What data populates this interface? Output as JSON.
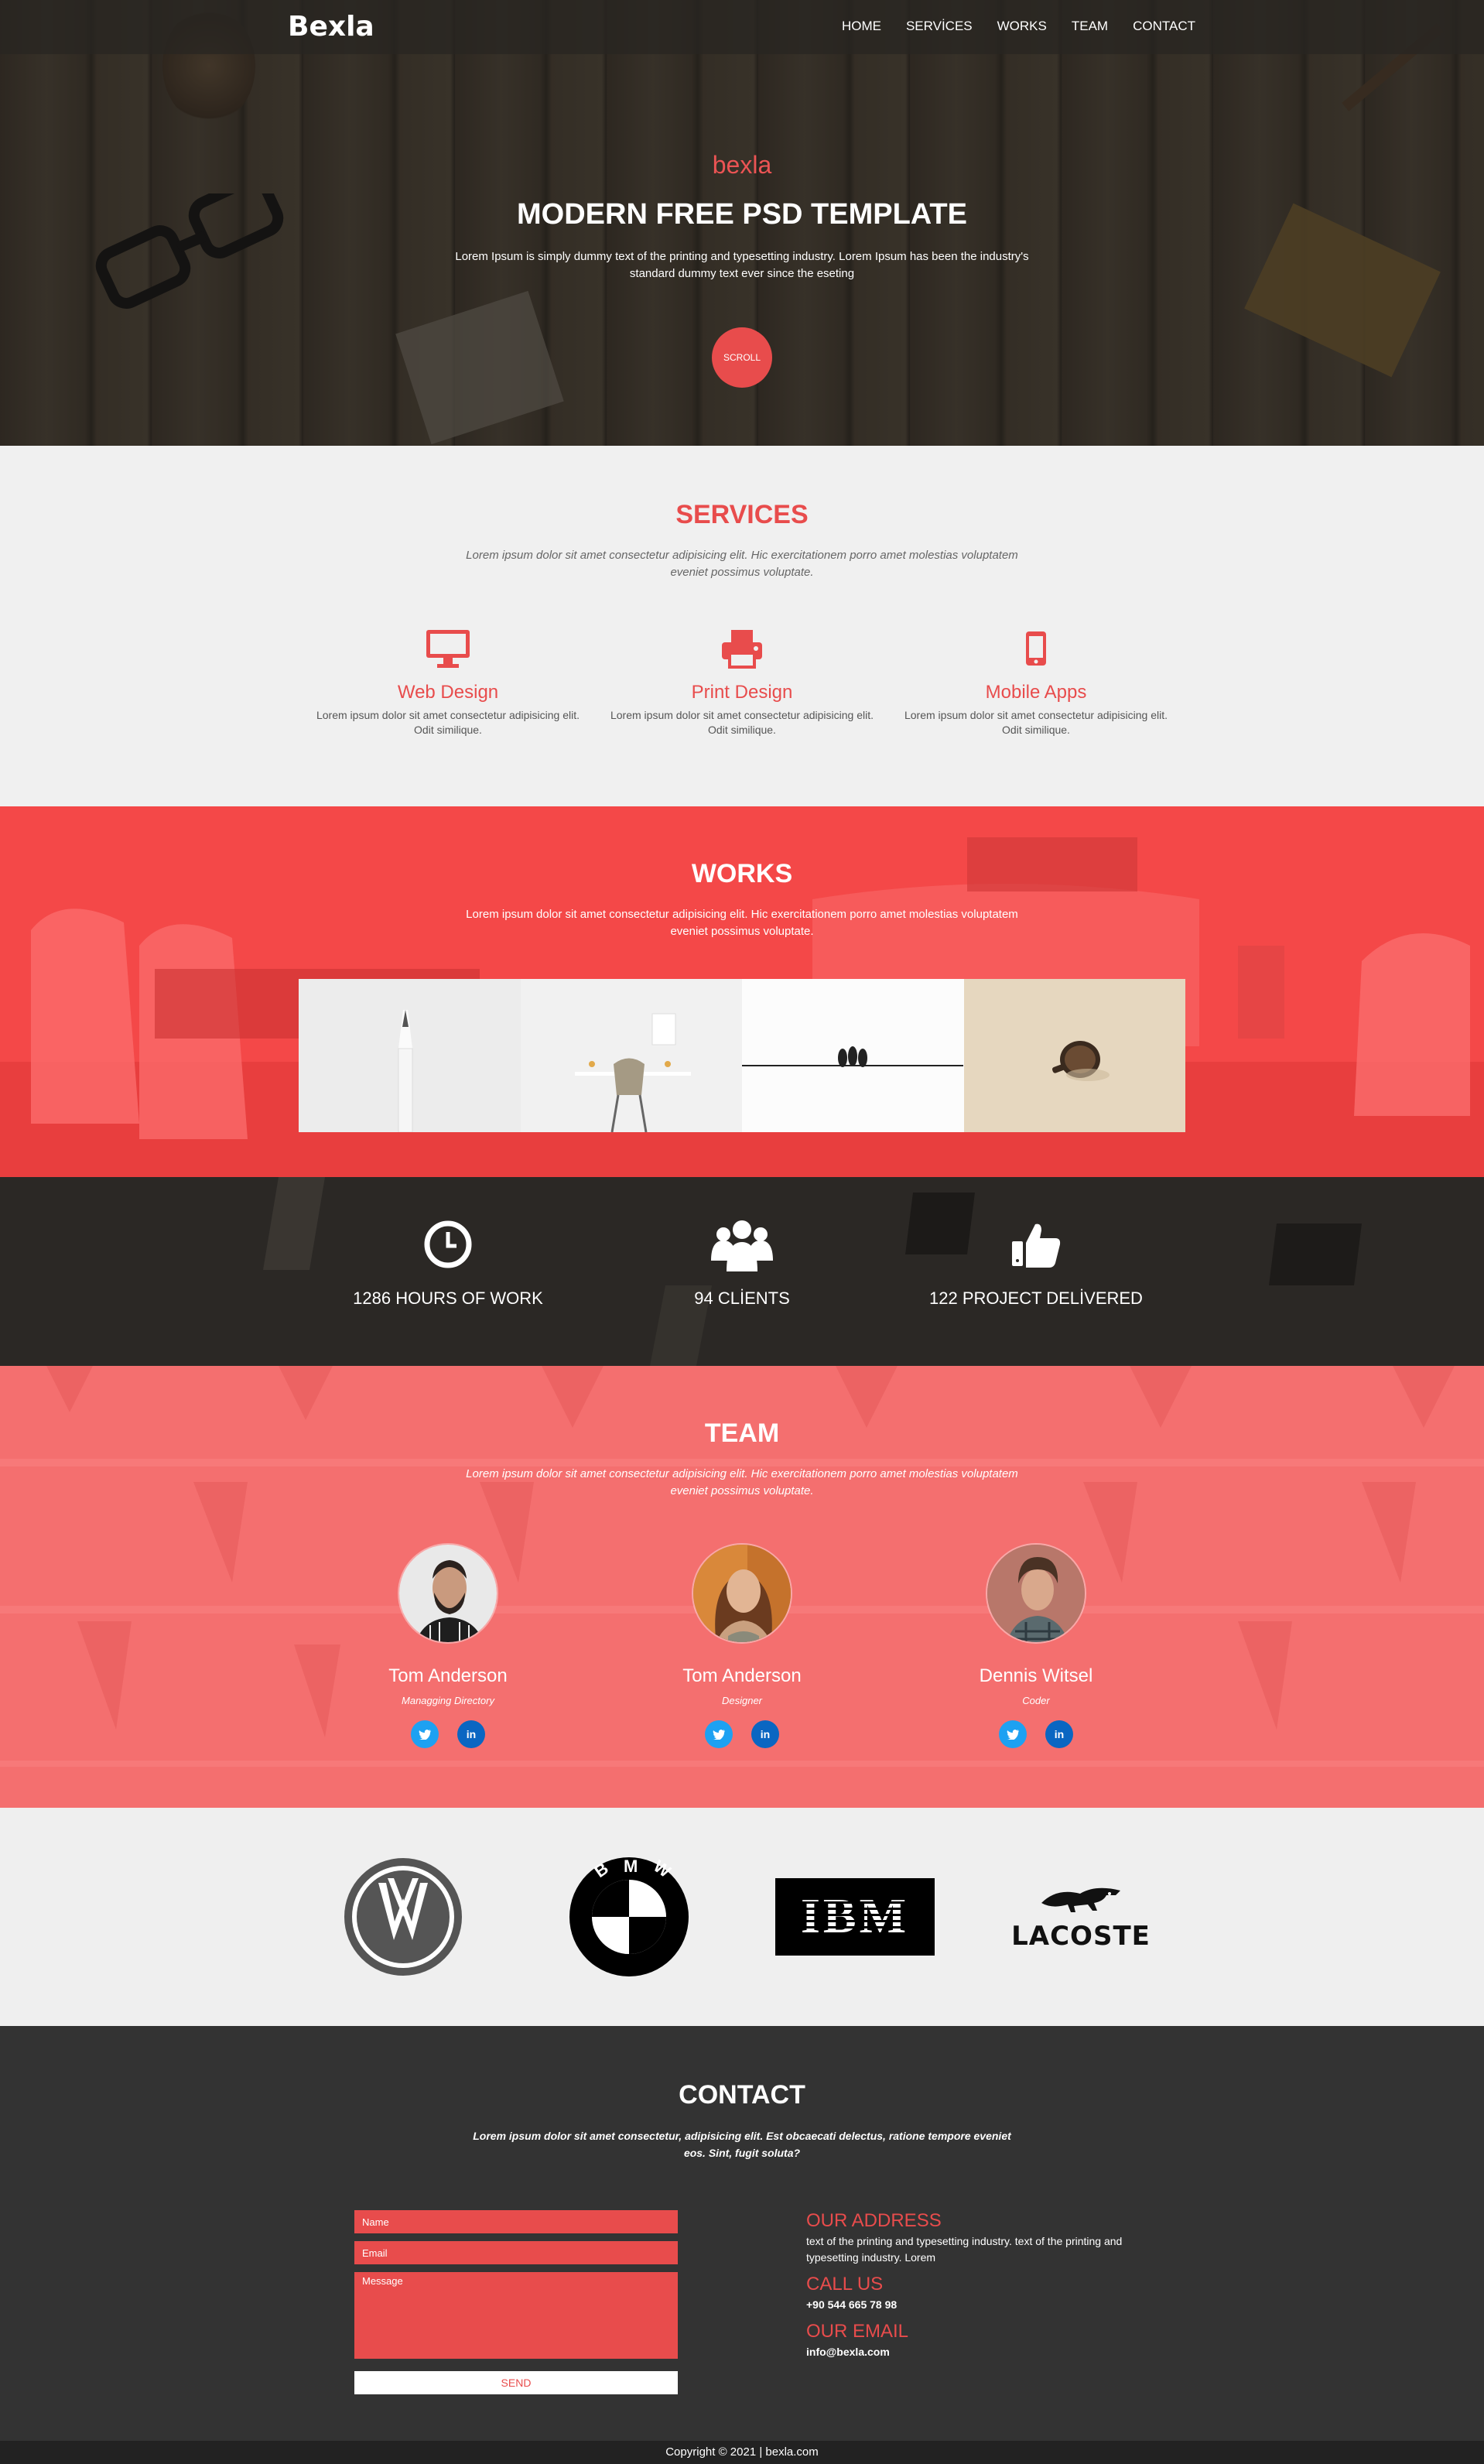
{
  "nav": {
    "logo": "Bexla",
    "items": [
      "HOME",
      "SERVİCES",
      "WORKS",
      "TEAM",
      "CONTACT"
    ]
  },
  "hero": {
    "brand": "bexla",
    "title": "MODERN FREE PSD TEMPLATE",
    "text": "Lorem Ipsum is simply dummy text of the printing and typesetting industry. Lorem Ipsum has been the industry's standard dummy text ever since the eseting",
    "scroll_label": "SCROLL"
  },
  "services": {
    "title": "SERVICES",
    "subtitle": "Lorem ipsum dolor sit amet consectetur adipisicing elit. Hic exercitationem porro amet molestias voluptatem eveniet possimus voluptate.",
    "items": [
      {
        "icon": "monitor-icon",
        "name": "Web Design",
        "text": "Lorem ipsum dolor sit amet consectetur adipisicing elit. Odit similique."
      },
      {
        "icon": "printer-icon",
        "name": "Print Design",
        "text": "Lorem ipsum dolor sit amet consectetur adipisicing elit. Odit similique."
      },
      {
        "icon": "mobile-icon",
        "name": "Mobile Apps",
        "text": "Lorem ipsum dolor sit amet consectetur adipisicing elit. Odit similique."
      }
    ]
  },
  "works": {
    "title": "WORKS",
    "subtitle": "Lorem ipsum dolor sit amet consectetur adipisicing elit. Hic exercitationem porro amet molestias voluptatem eveniet possimus voluptate."
  },
  "stats": [
    {
      "icon": "clock-icon",
      "label": "1286 HOURS OF WORK"
    },
    {
      "icon": "users-icon",
      "label": "94 CLİENTS"
    },
    {
      "icon": "thumbs-up-icon",
      "label": "122 PROJECT DELİVERED"
    }
  ],
  "team": {
    "title": "TEAM",
    "subtitle": "Lorem ipsum dolor sit amet consectetur adipisicing elit. Hic exercitationem porro amet molestias voluptatem eveniet possimus voluptate.",
    "members": [
      {
        "name": "Tom Anderson",
        "role": "Managging Directory"
      },
      {
        "name": "Tom Anderson",
        "role": "Designer"
      },
      {
        "name": "Dennis Witsel",
        "role": "Coder"
      }
    ]
  },
  "brands": [
    "vw-logo",
    "bmw-logo",
    "ibm-logo",
    "LACOSTE"
  ],
  "contact": {
    "title": "CONTACT",
    "subtitle": "Lorem ipsum dolor sit amet consectetur, adipisicing elit. Est obcaecati delectus, ratione tempore eveniet eos. Sint, fugit soluta?",
    "form": {
      "name_placeholder": "Name",
      "email_placeholder": "Email",
      "message_placeholder": "Message",
      "send_label": "SEND"
    },
    "address_title": "OUR ADDRESS",
    "address_text": "text of the printing and typesetting industry. text of the printing and typesetting industry. Lorem",
    "call_title": "CALL US",
    "phone": "+90 544 665 78 98",
    "email_title": "OUR EMAIL",
    "email": "info@bexla.com"
  },
  "footer": {
    "text": "Copyright © 2021 | bexla.com"
  },
  "colors": {
    "accent": "#e84c4c",
    "dark": "#333333",
    "team_bg": "#f56f6f"
  }
}
